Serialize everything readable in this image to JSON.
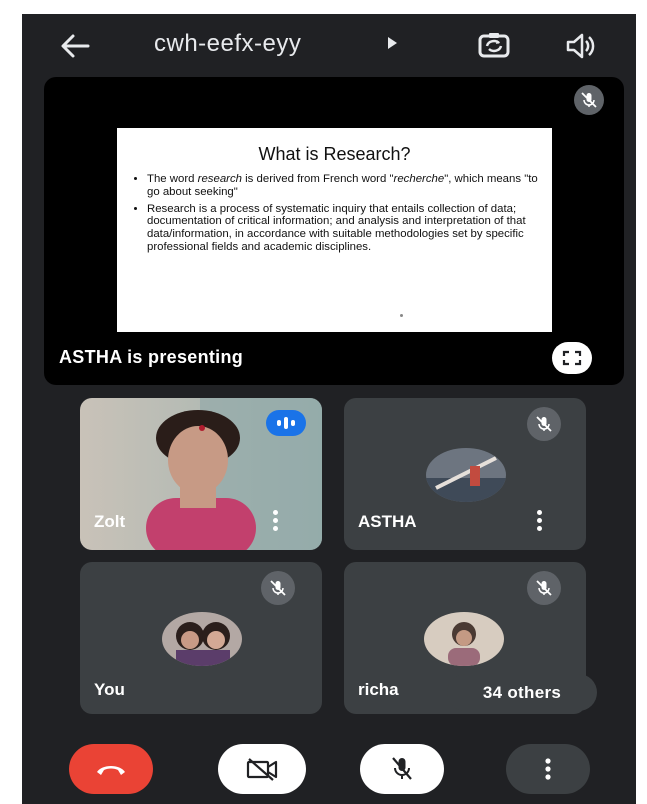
{
  "header": {
    "meeting_code": "cwh-eefx-eyy",
    "back_icon": "arrow-left-icon",
    "switch_camera_icon": "switch-camera-icon",
    "speaker_icon": "speaker-icon"
  },
  "presentation": {
    "presenter_label": "ASTHA is presenting",
    "slide": {
      "title": "What is Research?",
      "bullet1_pre": "The word ",
      "bullet1_em1": "research",
      "bullet1_mid": " is derived from French word \"",
      "bullet1_em2": "recherche",
      "bullet1_post": "\", which means \"to go about seeking\"",
      "bullet2": "Research is a process of systematic inquiry that entails collection of data; documentation of critical information; and analysis and interpretation of that data/information, in accordance with suitable methodologies set by specific professional fields and academic disciplines."
    }
  },
  "participants": [
    {
      "name": "Zolt",
      "state": "speaking"
    },
    {
      "name": "ASTHA",
      "state": "muted"
    },
    {
      "name": "You",
      "state": "muted"
    },
    {
      "name": "richa",
      "state": "muted"
    }
  ],
  "others_label": "34 others",
  "controls": {
    "end_call_icon": "end-call-icon",
    "camera_off_icon": "camera-off-icon",
    "mic_off_icon": "mic-off-icon",
    "more_icon": "more-options-icon"
  },
  "colors": {
    "background": "#202124",
    "tile": "#3c4043",
    "end_call": "#ea4335",
    "speaking": "#1a73e8"
  }
}
